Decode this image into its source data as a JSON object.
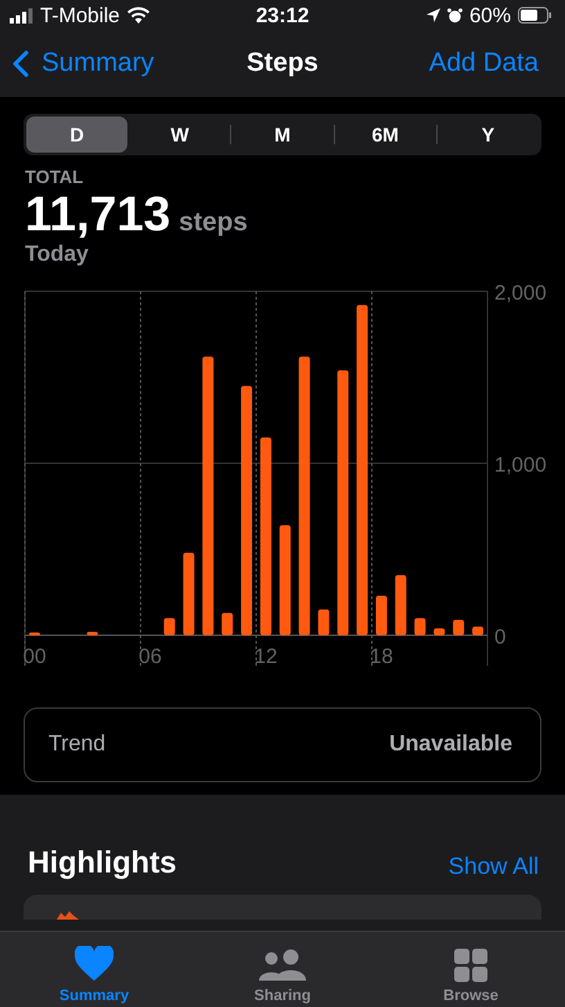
{
  "status_bar": {
    "carrier": "T-Mobile",
    "time": "23:12",
    "battery": "60%"
  },
  "nav": {
    "back": "Summary",
    "title": "Steps",
    "action": "Add Data"
  },
  "ranges": [
    {
      "label": "D",
      "selected": true
    },
    {
      "label": "W",
      "selected": false
    },
    {
      "label": "M",
      "selected": false
    },
    {
      "label": "6M",
      "selected": false
    },
    {
      "label": "Y",
      "selected": false
    }
  ],
  "total": {
    "caption": "TOTAL",
    "value": "11,713",
    "unit": "steps",
    "period": "Today"
  },
  "chart_data": {
    "type": "bar",
    "x": [
      0,
      1,
      2,
      3,
      4,
      5,
      6,
      7,
      8,
      9,
      10,
      11,
      12,
      13,
      14,
      15,
      16,
      17,
      18,
      19,
      20,
      21,
      22,
      23
    ],
    "series": [
      {
        "color": "#ff5a0f",
        "values": [
          10,
          0,
          0,
          20,
          0,
          0,
          0,
          100,
          480,
          1620,
          130,
          1450,
          1150,
          640,
          1620,
          150,
          1540,
          1920,
          230,
          350,
          100,
          40,
          90,
          50
        ]
      }
    ],
    "xlim": [
      -0.5,
      23.5
    ],
    "ylim": [
      0,
      2000
    ],
    "yticks": [
      {
        "value": 0,
        "label": "0"
      },
      {
        "value": 1000,
        "label": "1,000"
      },
      {
        "value": 2000,
        "label": "2,000"
      }
    ],
    "xticks": [
      {
        "value": 0,
        "label": "00"
      },
      {
        "value": 6,
        "label": "06"
      },
      {
        "value": 12,
        "label": "12"
      },
      {
        "value": 18,
        "label": "18"
      }
    ]
  },
  "trend": {
    "label": "Trend",
    "value": "Unavailable"
  },
  "highlights": {
    "title": "Highlights",
    "action": "Show All"
  },
  "tab_bar": [
    {
      "label": "Summary",
      "kind": "heart",
      "selected": true
    },
    {
      "label": "Sharing",
      "kind": "people",
      "selected": false
    },
    {
      "label": "Browse",
      "kind": "grid",
      "selected": false
    }
  ]
}
